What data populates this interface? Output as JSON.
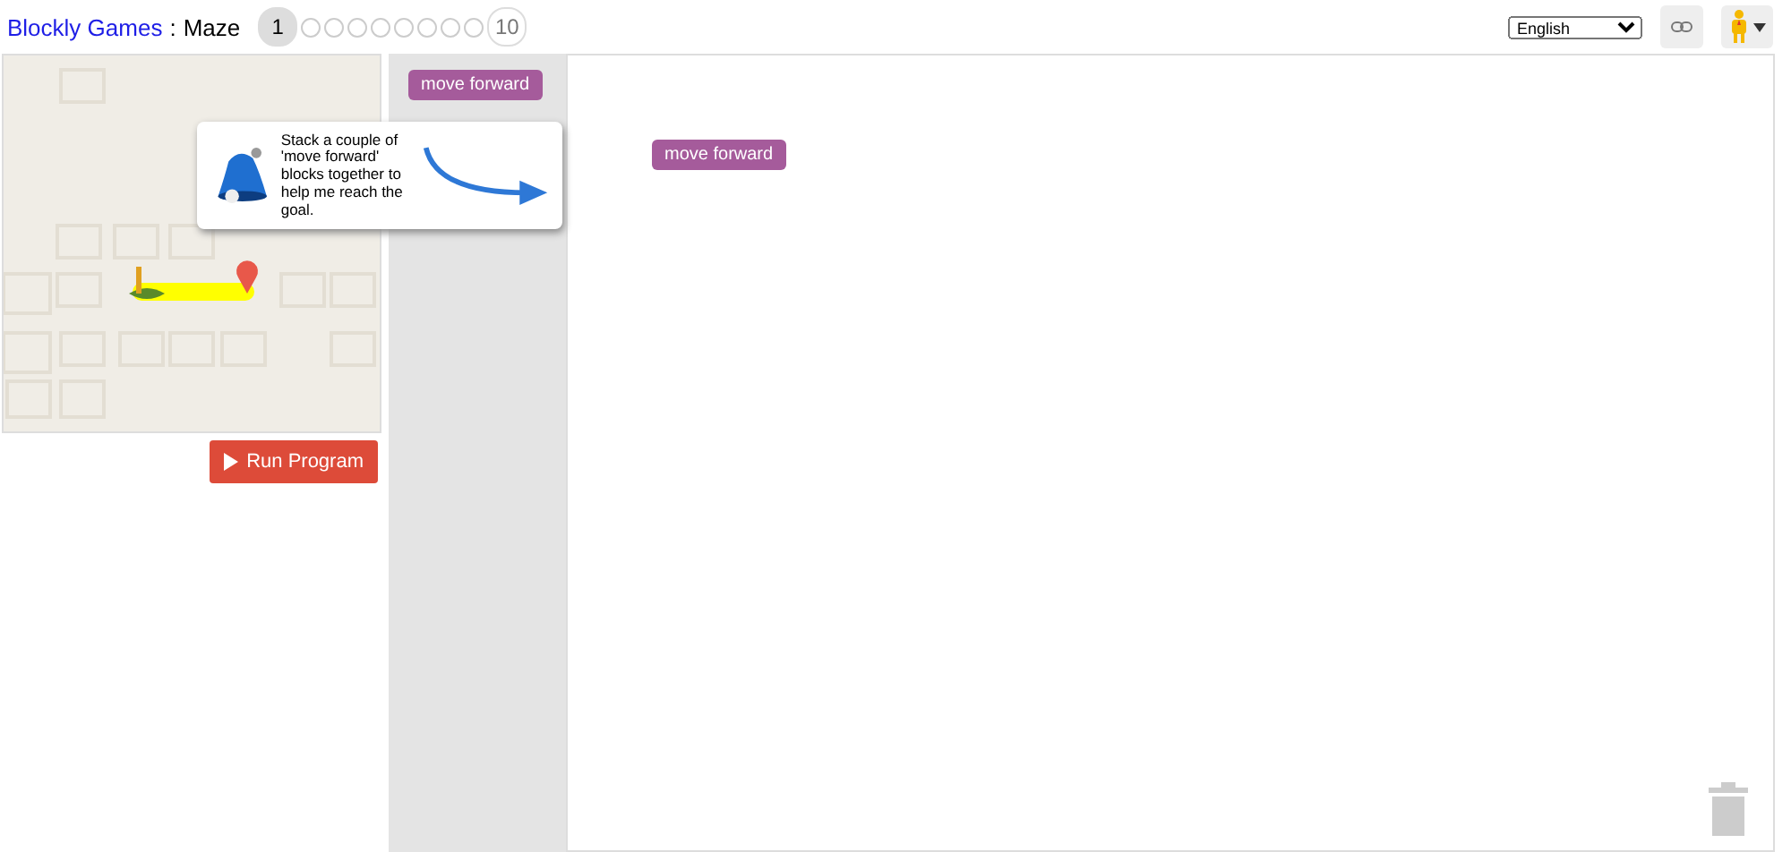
{
  "header": {
    "brand": "Blockly Games",
    "separator": ":",
    "game": "Maze"
  },
  "levels": [
    {
      "label": "1",
      "selected": true
    },
    {
      "selected": false
    },
    {
      "selected": false
    },
    {
      "selected": false
    },
    {
      "selected": false
    },
    {
      "selected": false
    },
    {
      "selected": false
    },
    {
      "selected": false
    },
    {
      "selected": false
    },
    {
      "label": "10",
      "selected": false
    }
  ],
  "language": {
    "value": "English"
  },
  "run_button": {
    "label": "Run Program"
  },
  "hint": {
    "text": "Stack a couple of 'move forward' blocks together to help me reach the goal."
  },
  "toolbox": {
    "blocks": [
      {
        "label": "move forward"
      }
    ]
  },
  "workspace": {
    "blocks": [
      {
        "label": "move forward"
      }
    ]
  }
}
